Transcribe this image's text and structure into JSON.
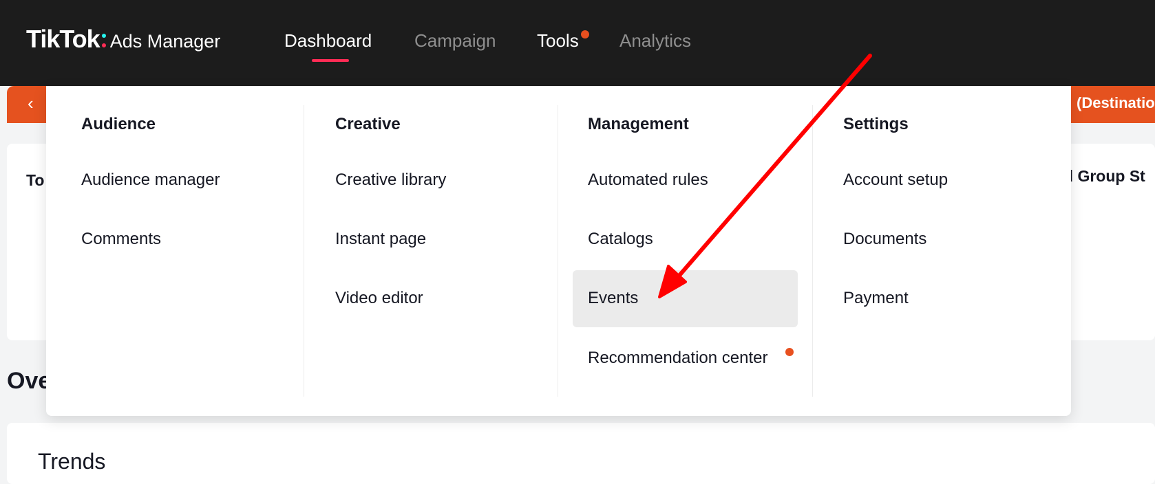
{
  "header": {
    "brand": "TikTok",
    "product": "Ads Manager"
  },
  "nav": {
    "items": [
      {
        "label": "Dashboard"
      },
      {
        "label": "Campaign"
      },
      {
        "label": "Tools"
      },
      {
        "label": "Analytics"
      }
    ]
  },
  "banner": {
    "back_glyph": "‹",
    "text": "(Destination"
  },
  "background": {
    "card_left_text": "To",
    "card_right_text": "d Group St",
    "overview_text": "Ove",
    "trends_title": "Trends"
  },
  "menu": {
    "columns": [
      {
        "title": "Audience",
        "items": [
          "Audience manager",
          "Comments"
        ]
      },
      {
        "title": "Creative",
        "items": [
          "Creative library",
          "Instant page",
          "Video editor"
        ]
      },
      {
        "title": "Management",
        "items": [
          "Automated rules",
          "Catalogs",
          "Events",
          "Recommendation center"
        ]
      },
      {
        "title": "Settings",
        "items": [
          "Account setup",
          "Documents",
          "Payment"
        ]
      }
    ],
    "highlighted_item": "Events"
  },
  "colors": {
    "topbar_bg": "#1c1c1c",
    "accent_pink": "#fe2c55",
    "accent_cyan": "#25f4ee",
    "banner_orange": "#e5521f",
    "notification_dot": "#e8501f",
    "annotation_arrow": "#ff0000"
  }
}
